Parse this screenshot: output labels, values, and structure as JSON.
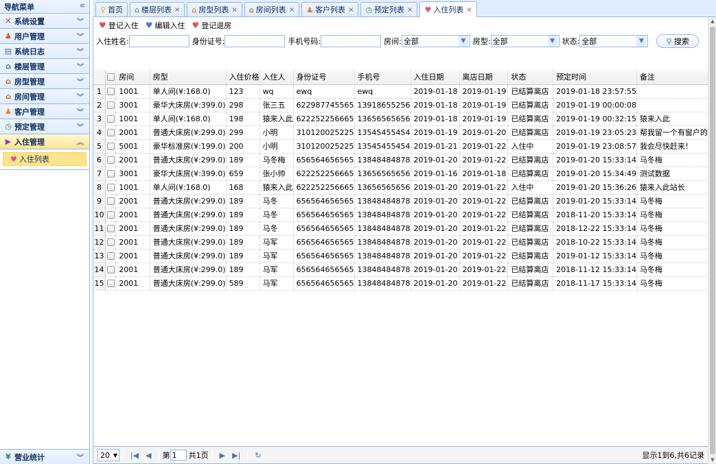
{
  "sidebar": {
    "title": "导航菜单",
    "items": [
      {
        "label": "系统设置",
        "icon": "tools-icon"
      },
      {
        "label": "用户管理",
        "icon": "users-icon"
      },
      {
        "label": "系统日志",
        "icon": "log-icon"
      },
      {
        "label": "楼层管理",
        "icon": "building-icon"
      },
      {
        "label": "房型管理",
        "icon": "house-icon"
      },
      {
        "label": "房间管理",
        "icon": "house-icon"
      },
      {
        "label": "客户管理",
        "icon": "customers-icon"
      },
      {
        "label": "预定管理",
        "icon": "clock-icon"
      },
      {
        "label": "入住管理",
        "icon": "folder-icon"
      }
    ],
    "active_sub": "入住列表",
    "bottom": "营业统计"
  },
  "tabs": [
    {
      "label": "首页",
      "icon": "bulb-icon",
      "closable": false
    },
    {
      "label": "楼层列表",
      "icon": "building-icon",
      "closable": true
    },
    {
      "label": "房型列表",
      "icon": "house-icon",
      "closable": true
    },
    {
      "label": "房间列表",
      "icon": "house-icon",
      "closable": true
    },
    {
      "label": "客户列表",
      "icon": "user-icon",
      "closable": true
    },
    {
      "label": "预定列表",
      "icon": "clock-icon",
      "closable": true
    },
    {
      "label": "入住列表",
      "icon": "heart-icon",
      "closable": true
    }
  ],
  "toolbar": {
    "add": "登记入住",
    "edit": "编辑入住",
    "checkout": "登记退房"
  },
  "search": {
    "name_label": "入住姓名:",
    "name_value": "",
    "id_label": "身份证号:",
    "id_value": "",
    "phone_label": "手机号码:",
    "phone_value": "",
    "room_label": "房间:",
    "room_value": "全部",
    "roomtype_label": "房型:",
    "roomtype_value": "全部",
    "status_label": "状态:",
    "status_value": "全部",
    "button": "搜索"
  },
  "table": {
    "headers": [
      "房间",
      "房型",
      "入住价格",
      "入住人",
      "身份证号",
      "手机号",
      "入住日期",
      "离店日期",
      "状态",
      "预定时间",
      "备注"
    ],
    "rows": [
      [
        "1",
        "1001",
        "单人间(¥:168.0)",
        "123",
        "wq",
        "ewq",
        "ewq",
        "2019-01-18",
        "2019-01-19",
        "已结算离店",
        "2019-01-18 23:57:55",
        ""
      ],
      [
        "2",
        "3001",
        "豪华大床房(¥:399.0)",
        "298",
        "张三五",
        "622987745565",
        "13918655256",
        "2019-01-18",
        "2019-01-19",
        "已结算离店",
        "2019-01-19 00:00:08",
        ""
      ],
      [
        "3",
        "1001",
        "单人间(¥:168.0)",
        "198",
        "猿来入此",
        "622252256665",
        "13656565656",
        "2019-01-18",
        "2019-01-19",
        "已结算离店",
        "2019-01-19 00:32:15",
        "猿来入此"
      ],
      [
        "4",
        "2001",
        "普通大床房(¥:299.0)",
        "299",
        "小明",
        "310120025225",
        "13545455454",
        "2019-01-19",
        "2019-01-20",
        "已结算离店",
        "2019-01-19 23:05:23",
        "帮我留一个有窗户的"
      ],
      [
        "5",
        "5001",
        "豪华标准房(¥:199.0)",
        "200",
        "小明",
        "310120025225",
        "13545455454",
        "2019-01-21",
        "2019-01-22",
        "入住中",
        "2019-01-19 23:08:57",
        "我会尽快赶来！"
      ],
      [
        "6",
        "2001",
        "普通大床房(¥:299.0)",
        "189",
        "马冬梅",
        "656564656565",
        "13848484878",
        "2019-01-20",
        "2019-01-22",
        "已结算离店",
        "2019-01-20 15:33:14",
        "马冬梅"
      ],
      [
        "7",
        "3001",
        "豪华大床房(¥:399.0)",
        "659",
        "张小帅",
        "622252256665",
        "13656565656",
        "2019-01-16",
        "2019-01-18",
        "已结算离店",
        "2019-01-20 15:34:49",
        "测试数据"
      ],
      [
        "8",
        "1001",
        "单人间(¥:168.0)",
        "168",
        "猿来入此",
        "622252256665",
        "13656565656",
        "2019-01-20",
        "2019-01-22",
        "入住中",
        "2019-01-20 15:36:26",
        "猿来入此站长"
      ],
      [
        "9",
        "2001",
        "普通大床房(¥:299.0)",
        "189",
        "马冬",
        "656564656565",
        "13848484878",
        "2019-01-20",
        "2019-01-22",
        "已结算离店",
        "2019-01-20 15:33:14",
        "马冬梅"
      ],
      [
        "10",
        "2001",
        "普通大床房(¥:299.0)",
        "189",
        "马冬",
        "656564656565",
        "13848484878",
        "2019-01-20",
        "2019-01-22",
        "已结算离店",
        "2018-11-20 15:33:14",
        "马冬梅"
      ],
      [
        "11",
        "2001",
        "普通大床房(¥:299.0)",
        "189",
        "马冬",
        "656564656565",
        "13848484878",
        "2019-01-20",
        "2019-01-22",
        "已结算离店",
        "2018-12-22 15:33:14",
        "马冬梅"
      ],
      [
        "12",
        "2001",
        "普通大床房(¥:299.0)",
        "189",
        "马军",
        "656564656565",
        "13848484878",
        "2019-01-20",
        "2019-01-22",
        "已结算离店",
        "2018-10-22 15:33:14",
        "马冬梅"
      ],
      [
        "13",
        "2001",
        "普通大床房(¥:299.0)",
        "189",
        "马军",
        "656564656565",
        "13848484878",
        "2019-01-20",
        "2019-01-22",
        "已结算离店",
        "2019-01-12 15:33:14",
        "马冬梅"
      ],
      [
        "14",
        "2001",
        "普通大床房(¥:299.0)",
        "189",
        "马军",
        "656564656565",
        "13848484878",
        "2019-01-20",
        "2019-01-22",
        "已结算离店",
        "2018-11-12 15:33:14",
        "马冬梅"
      ],
      [
        "15",
        "2001",
        "普通大床房(¥:299.0)",
        "589",
        "马军",
        "656564656565",
        "13848484878",
        "2019-01-20",
        "2019-01-22",
        "已结算离店",
        "2018-11-17 15:33:14",
        "马冬梅"
      ]
    ]
  },
  "pager": {
    "page_size": "20",
    "page_prefix": "第",
    "page_value": "1",
    "page_suffix": "共1页",
    "info": "显示1到6,共6记录"
  },
  "colors": {
    "border": "#95b8e7",
    "header_bg": "#e0ecff",
    "active_menu": "#ffe48d"
  }
}
